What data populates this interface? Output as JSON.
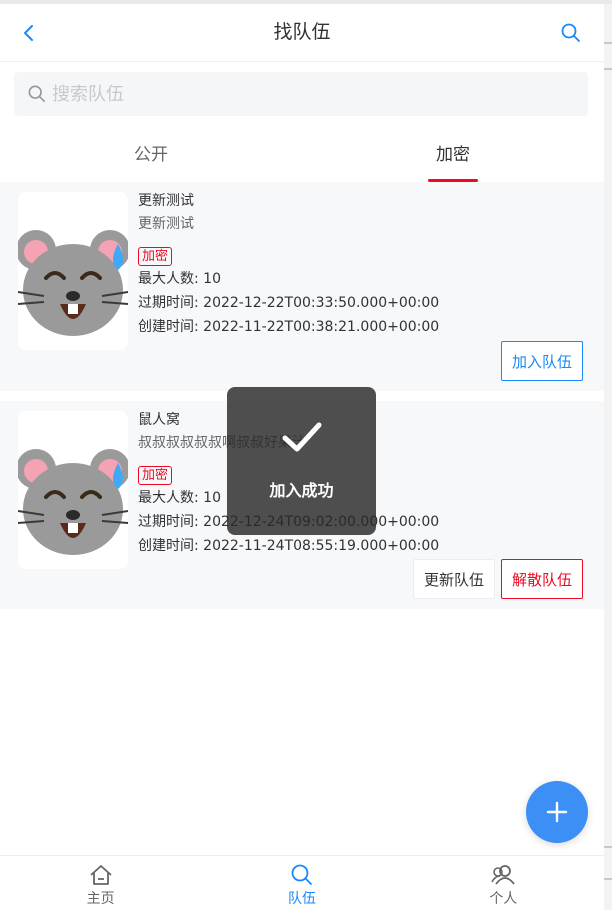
{
  "header": {
    "title": "找队伍"
  },
  "search": {
    "placeholder": "搜索队伍",
    "value": ""
  },
  "tabs": [
    {
      "label": "公开",
      "active": false
    },
    {
      "label": "加密",
      "active": true
    }
  ],
  "teams": [
    {
      "name": "更新测试",
      "description": "更新测试",
      "tag": "加密",
      "max_members": "最大人数: 10",
      "expire_time": "过期时间: 2022-12-22T00:33:50.000+00:00",
      "create_time": "创建时间: 2022-11-22T00:38:21.000+00:00",
      "actions": [
        "加入队伍"
      ]
    },
    {
      "name": "鼠人窝",
      "description": "叔叔叔叔叔叔啊叔叔好果汁",
      "tag": "加密",
      "max_members": "最大人数: 10",
      "expire_time": "过期时间: 2022-12-24T09:02:00.000+00:00",
      "create_time": "创建时间: 2022-11-24T08:55:19.000+00:00",
      "actions": [
        "更新队伍",
        "解散队伍"
      ]
    }
  ],
  "toast": {
    "text": "加入成功",
    "icon": "check-icon"
  },
  "fab": {
    "icon": "plus-icon"
  },
  "tabbar": [
    {
      "label": "主页",
      "icon": "home-icon",
      "active": false
    },
    {
      "label": "队伍",
      "icon": "search-icon",
      "active": true
    },
    {
      "label": "个人",
      "icon": "user-group-icon",
      "active": false
    }
  ],
  "colors": {
    "accent": "#1989fa",
    "danger": "#ee0a24",
    "fab": "#3b8ff5",
    "card_bg": "#f7f8fa"
  }
}
